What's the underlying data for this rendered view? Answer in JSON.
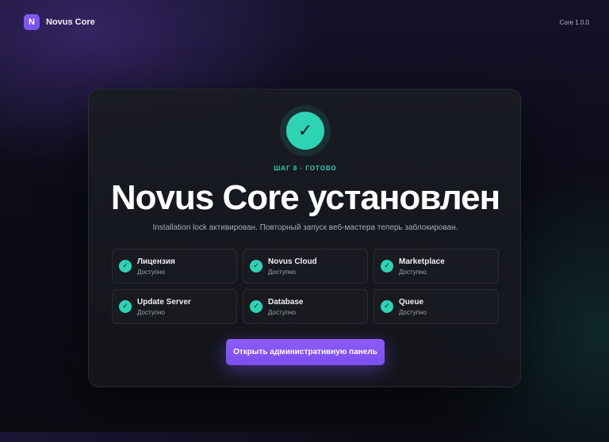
{
  "header": {
    "logo_letter": "N",
    "brand": "Novus Core",
    "version": "Core 1.0.0"
  },
  "card": {
    "check_glyph": "✓",
    "step_label": "ШАГ 8 · ГОТОВО",
    "title": "Novus Core установлен",
    "subtitle": "Installation lock активирован. Повторный запуск веб-мастера теперь заблокирован.",
    "services": [
      {
        "name": "Лицензия",
        "status": "Доступно"
      },
      {
        "name": "Novus Cloud",
        "status": "Доступно"
      },
      {
        "name": "Marketplace",
        "status": "Доступно"
      },
      {
        "name": "Update Server",
        "status": "Доступно"
      },
      {
        "name": "Database",
        "status": "Доступно"
      },
      {
        "name": "Queue",
        "status": "Доступно"
      }
    ],
    "cta_label": "Открыть административную панель"
  },
  "colors": {
    "accent": "#8b5cf6",
    "success": "#2dd4b4",
    "card_bg": "#1a1c24"
  }
}
